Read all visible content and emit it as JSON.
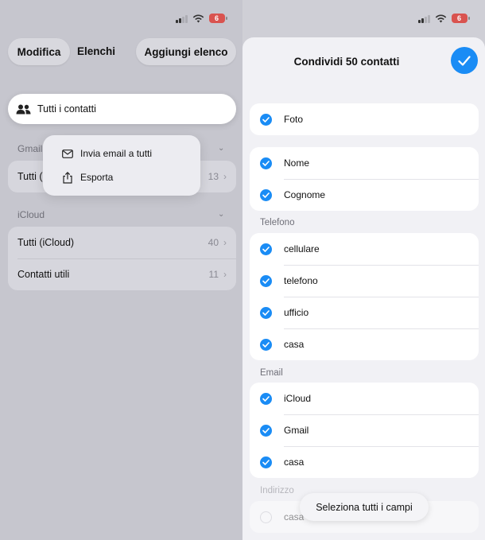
{
  "left": {
    "status": {
      "battery": "6"
    },
    "nav": {
      "edit_label": "Modifica",
      "title": "Elenchi",
      "add_label": "Aggiungi elenco"
    },
    "all_contacts": {
      "icon": "people-icon",
      "label": "Tutti i contatti"
    },
    "gmail": {
      "header": "Gmail",
      "rows": [
        {
          "label": "Tutti (",
          "count": "13"
        }
      ]
    },
    "context_menu": [
      {
        "icon": "envelope-icon",
        "label": "Invia email a tutti"
      },
      {
        "icon": "export-icon",
        "label": "Esporta"
      }
    ],
    "icloud": {
      "header": "iCloud",
      "rows": [
        {
          "label": "Tutti (iCloud)",
          "count": "40"
        },
        {
          "label": "Contatti utili",
          "count": "11"
        }
      ]
    }
  },
  "right": {
    "status": {
      "battery": "6"
    },
    "title": "Condividi 50 contatti",
    "photo_section": [
      {
        "label": "Foto",
        "checked": true
      }
    ],
    "name_section": [
      {
        "label": "Nome",
        "checked": true
      },
      {
        "label": "Cognome",
        "checked": true
      }
    ],
    "phone": {
      "header": "Telefono",
      "items": [
        {
          "label": "cellulare",
          "checked": true
        },
        {
          "label": "telefono",
          "checked": true
        },
        {
          "label": "ufficio",
          "checked": true
        },
        {
          "label": "casa",
          "checked": true
        }
      ]
    },
    "email": {
      "header": "Email",
      "items": [
        {
          "label": "iCloud",
          "checked": true
        },
        {
          "label": "Gmail",
          "checked": true
        },
        {
          "label": "casa",
          "checked": true
        }
      ]
    },
    "address": {
      "header": "Indirizzo",
      "items": [
        {
          "label": "casa",
          "checked": false
        }
      ]
    },
    "select_all_label": "Seleziona tutti i campi"
  },
  "colors": {
    "accent": "#1a8cf5",
    "battery": "#d9534f"
  }
}
